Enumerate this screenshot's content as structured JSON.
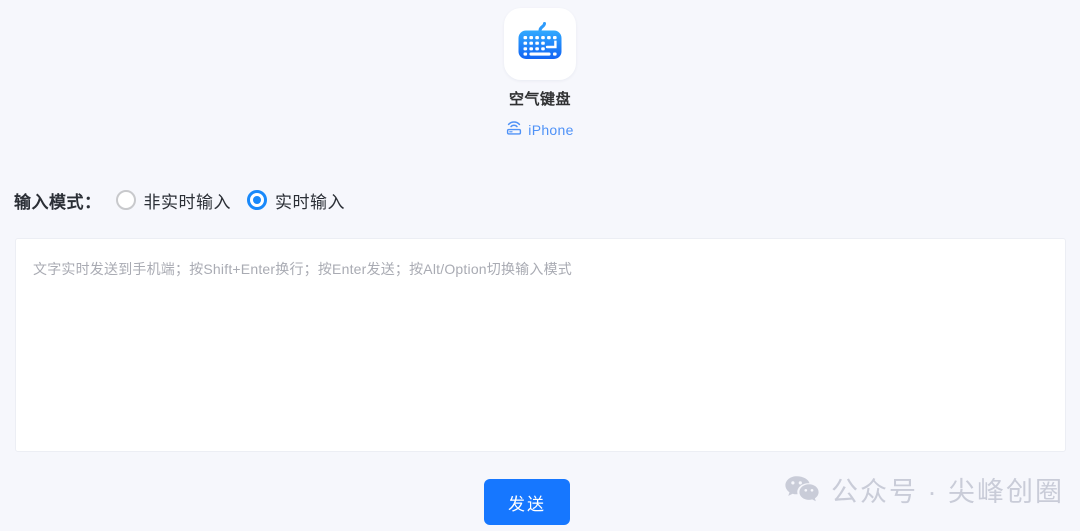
{
  "colors": {
    "page_background": "#f6f7fc",
    "accent_blue": "#1989fa",
    "button_blue": "#1677ff",
    "device_link_blue": "#4f92f7",
    "radio_unchecked_gray": "#c8c9cc",
    "placeholder_gray": "#a9abb3",
    "watermark_gray": "#c9ccd8",
    "title_text": "#303133",
    "panel_white": "#ffffff"
  },
  "device": {
    "app_icon_name": "keyboard-app-icon",
    "name": "空气键盘",
    "type_icon_name": "wireless-device-icon",
    "type_label": "iPhone"
  },
  "input_mode": {
    "label": "输入模式：",
    "options": [
      {
        "label": "非实时输入",
        "selected": false
      },
      {
        "label": "实时输入",
        "selected": true
      }
    ]
  },
  "editor": {
    "value": "",
    "placeholder": "文字实时发送到手机端；按Shift+Enter换行；按Enter发送；按Alt/Option切换输入模式"
  },
  "actions": {
    "send_label": "发送"
  },
  "watermark": {
    "icon_name": "wechat-icon",
    "text": "公众号 · 尖峰创圈"
  }
}
